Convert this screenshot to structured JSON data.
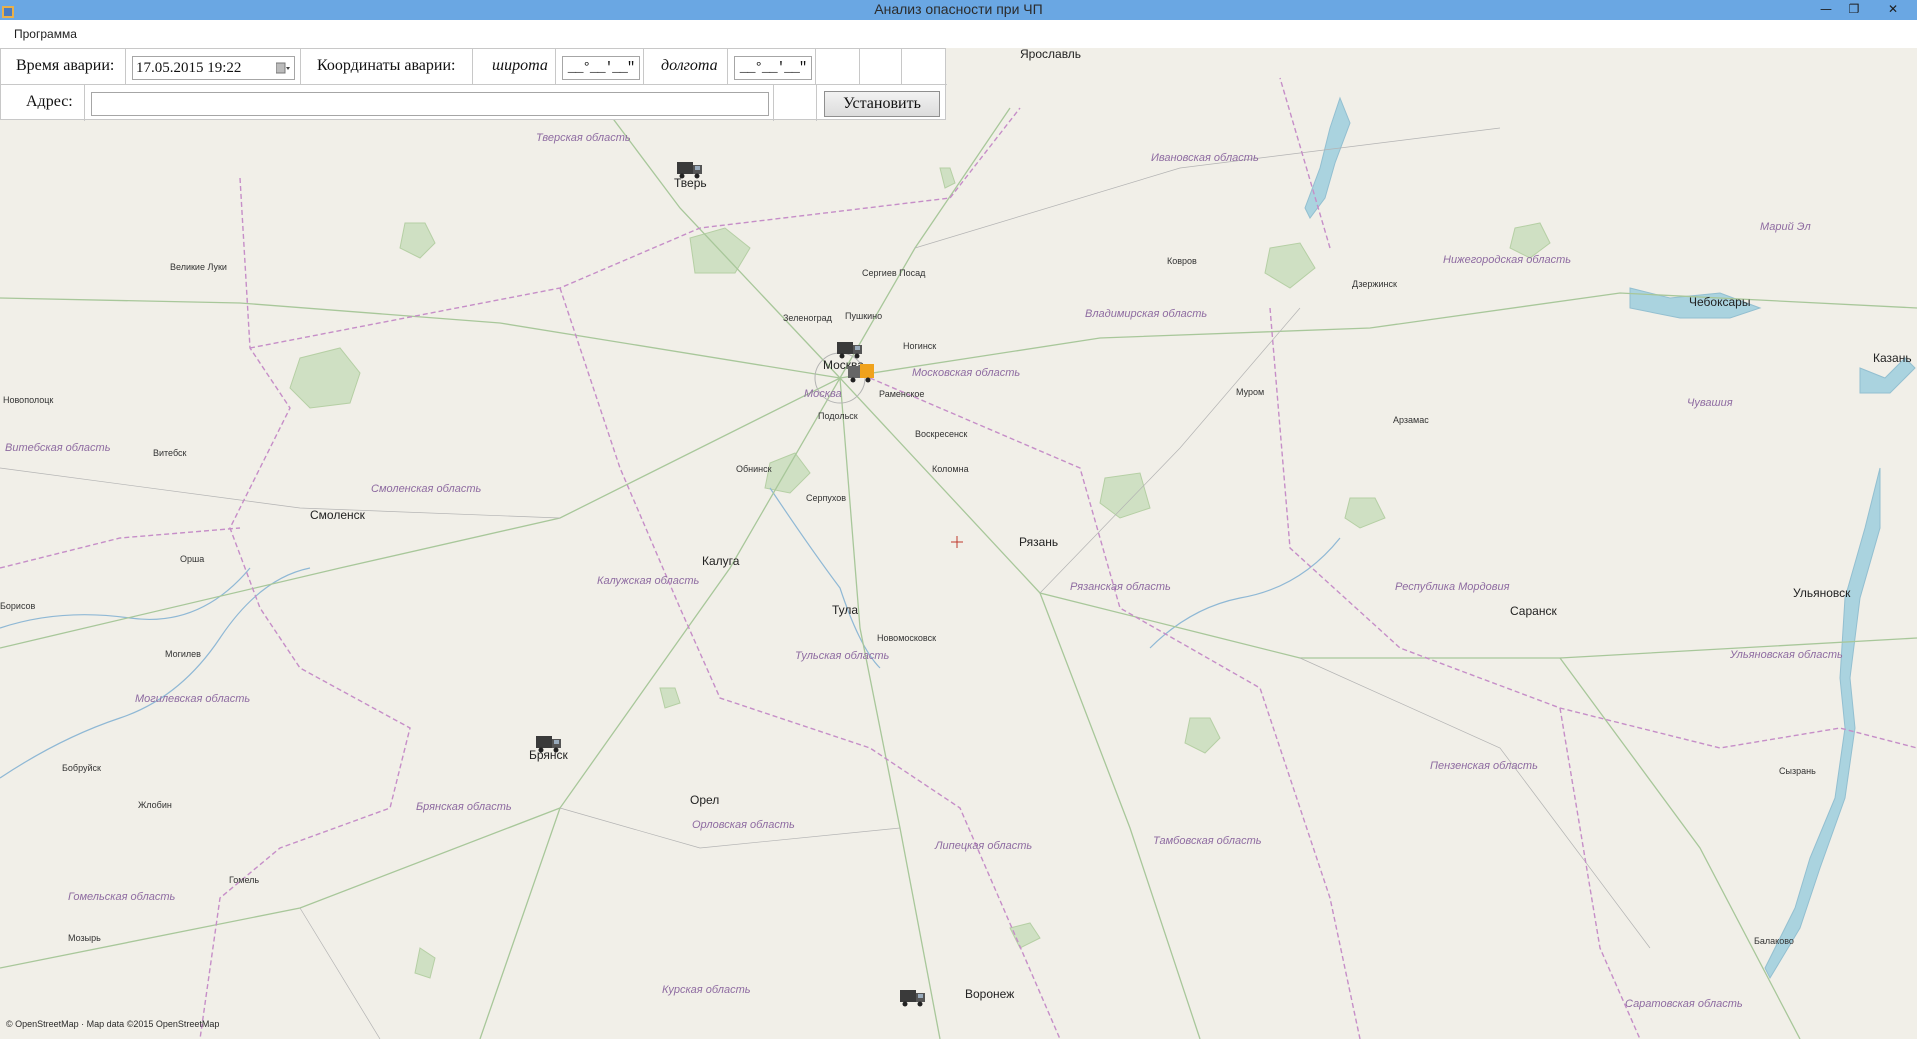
{
  "window": {
    "title": "Анализ опасности при ЧП",
    "controls": [
      "minimize",
      "restore",
      "close"
    ]
  },
  "menu": {
    "items": [
      {
        "label": "Программа"
      }
    ]
  },
  "panel": {
    "accident_time_label": "Время аварии:",
    "accident_time_value": "17.05.2015 19:22",
    "coords_label": "Координаты аварии:",
    "latitude_label": "широта",
    "latitude_value": "__°__'__\"",
    "longitude_label": "долгота",
    "longitude_value": "__°__'__\"",
    "address_label": "Адрес:",
    "address_value": "",
    "set_button": "Установить"
  },
  "map": {
    "attribution": "© OpenStreetMap · Map data ©2015 OpenStreetMap",
    "crosshair_color": "#c0392b",
    "cities": [
      {
        "name": "Ярославль",
        "cls": "city"
      },
      {
        "name": "Тверь",
        "cls": "city"
      },
      {
        "name": "Сергиев Посад",
        "cls": "town"
      },
      {
        "name": "Пушкино",
        "cls": "town"
      },
      {
        "name": "Зеленоград",
        "cls": "town"
      },
      {
        "name": "Москва",
        "cls": "city"
      },
      {
        "name": "Ногинск",
        "cls": "town"
      },
      {
        "name": "Раменское",
        "cls": "town"
      },
      {
        "name": "Подольск",
        "cls": "town"
      },
      {
        "name": "Воскресенск",
        "cls": "town"
      },
      {
        "name": "Обнинск",
        "cls": "town"
      },
      {
        "name": "Коломна",
        "cls": "town"
      },
      {
        "name": "Серпухов",
        "cls": "town"
      },
      {
        "name": "Ковров",
        "cls": "town"
      },
      {
        "name": "Дзержинск",
        "cls": "town"
      },
      {
        "name": "Чебоксары",
        "cls": "city"
      },
      {
        "name": "Казань",
        "cls": "city"
      },
      {
        "name": "Муром",
        "cls": "town"
      },
      {
        "name": "Арзамас",
        "cls": "town"
      },
      {
        "name": "Великие Луки",
        "cls": "town"
      },
      {
        "name": "Новополоцк",
        "cls": "town"
      },
      {
        "name": "Витебск",
        "cls": "town"
      },
      {
        "name": "Смоленск",
        "cls": "city"
      },
      {
        "name": "Орша",
        "cls": "town"
      },
      {
        "name": "Калуга",
        "cls": "city"
      },
      {
        "name": "Рязань",
        "cls": "city"
      },
      {
        "name": "Тула",
        "cls": "city"
      },
      {
        "name": "Новомосковск",
        "cls": "town"
      },
      {
        "name": "Саранск",
        "cls": "city"
      },
      {
        "name": "Ульяновск",
        "cls": "city"
      },
      {
        "name": "Борисов",
        "cls": "town"
      },
      {
        "name": "Могилев",
        "cls": "town"
      },
      {
        "name": "Брянск",
        "cls": "city"
      },
      {
        "name": "Бобруйск",
        "cls": "town"
      },
      {
        "name": "Жлобин",
        "cls": "town"
      },
      {
        "name": "Орел",
        "cls": "city"
      },
      {
        "name": "Сызрань",
        "cls": "town"
      },
      {
        "name": "Гомель",
        "cls": "town"
      },
      {
        "name": "Мозырь",
        "cls": "town"
      },
      {
        "name": "Балаково",
        "cls": "town"
      },
      {
        "name": "Воронеж",
        "cls": "city"
      }
    ],
    "regions": [
      {
        "name": "Тверская область"
      },
      {
        "name": "Ивановская область"
      },
      {
        "name": "Марий Эл"
      },
      {
        "name": "Нижегородская область"
      },
      {
        "name": "Владимирская область"
      },
      {
        "name": "Московская область"
      },
      {
        "name": "Москва"
      },
      {
        "name": "Чувашия"
      },
      {
        "name": "Витебская область"
      },
      {
        "name": "Смоленская область"
      },
      {
        "name": "Калужская область"
      },
      {
        "name": "Рязанская область"
      },
      {
        "name": "Республика Мордовия"
      },
      {
        "name": "Тульская область"
      },
      {
        "name": "Ульяновская область"
      },
      {
        "name": "Могилевская область"
      },
      {
        "name": "Пензенская область"
      },
      {
        "name": "Брянская область"
      },
      {
        "name": "Орловская область"
      },
      {
        "name": "Липецкая область"
      },
      {
        "name": "Тамбовская область"
      },
      {
        "name": "Гомельская область"
      },
      {
        "name": "Курская область"
      },
      {
        "name": "Саратовская область"
      }
    ]
  }
}
